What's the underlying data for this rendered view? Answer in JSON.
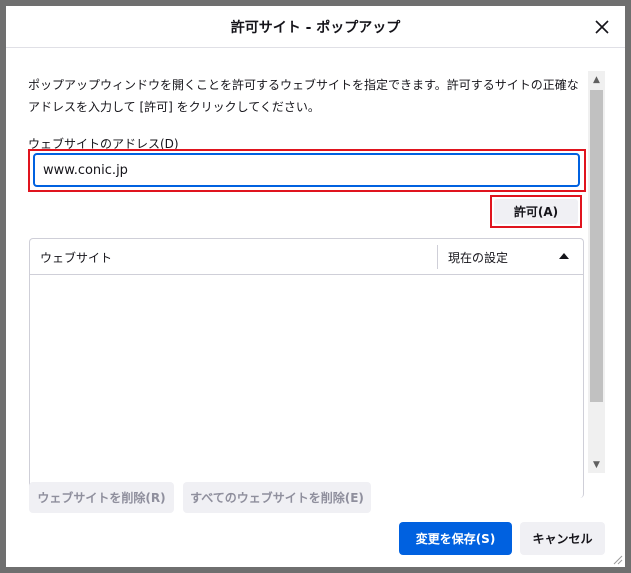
{
  "dialog": {
    "title": "許可サイト - ポップアップ",
    "description": "ポップアップウィンドウを開くことを許可するウェブサイトを指定できます。許可するサイトの正確なアドレスを入力して [許可] をクリックしてください。",
    "address_label": "ウェブサイトのアドレス(D)",
    "address_value": "www.conic.jp",
    "allow_label": "許可(A)"
  },
  "table": {
    "col_site": "ウェブサイト",
    "col_status": "現在の設定",
    "rows": []
  },
  "buttons": {
    "remove": "ウェブサイトを削除(R)",
    "remove_all": "すべてのウェブサイトを削除(E)",
    "save": "変更を保存(S)",
    "cancel": "キャンセル"
  },
  "colors": {
    "accent": "#0061e0",
    "highlight": "#e0141e"
  },
  "icons": {
    "close": "close-icon",
    "sort": "sort-ascending-icon",
    "resize": "resize-grip-icon"
  }
}
